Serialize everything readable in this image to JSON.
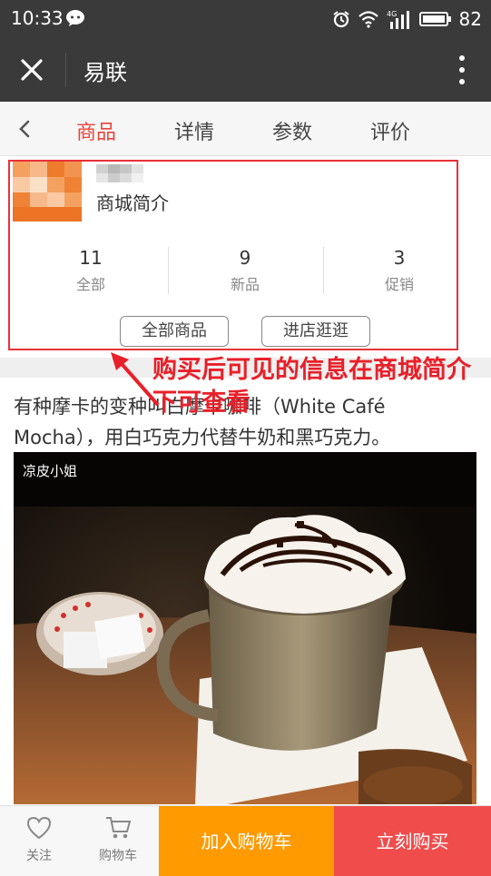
{
  "status_bar": {
    "time": "10:33",
    "battery": "82",
    "network": "4G",
    "icons": [
      "wechat-icon",
      "alarm-icon",
      "wifi-icon",
      "signal-icon",
      "battery-icon"
    ]
  },
  "app_bar": {
    "title": "易联",
    "icons": [
      "close-icon",
      "more-icon"
    ]
  },
  "tabs": [
    {
      "label": "商品",
      "active": true
    },
    {
      "label": "详情",
      "active": false
    },
    {
      "label": "参数",
      "active": false
    },
    {
      "label": "评价",
      "active": false
    }
  ],
  "shop": {
    "description_label": "商城简介",
    "stats": [
      {
        "value": "11",
        "label": "全部"
      },
      {
        "value": "9",
        "label": "新品"
      },
      {
        "value": "3",
        "label": "促销"
      }
    ],
    "buttons": {
      "all_products": "全部商品",
      "visit_store": "进店逛逛"
    }
  },
  "annotation": {
    "text": "购买后可见的信息在商城简介下可查看"
  },
  "article": {
    "text": "有种摩卡的变种叫白摩卡咖啡（White Café Mocha），用白巧克力代替牛奶和黑巧克力。",
    "image_caption": "凉皮小姐"
  },
  "bottom_bar": {
    "favorite_label": "关注",
    "cart_label": "购物车",
    "add_to_cart": "加入购物车",
    "buy_now": "立刻购买"
  },
  "colors": {
    "accent": "#e8453c",
    "header_bg": "#3a3a3a",
    "cart_button": "#ff9a00",
    "buy_button": "#f04c4c",
    "annotation": "#e8202a"
  }
}
